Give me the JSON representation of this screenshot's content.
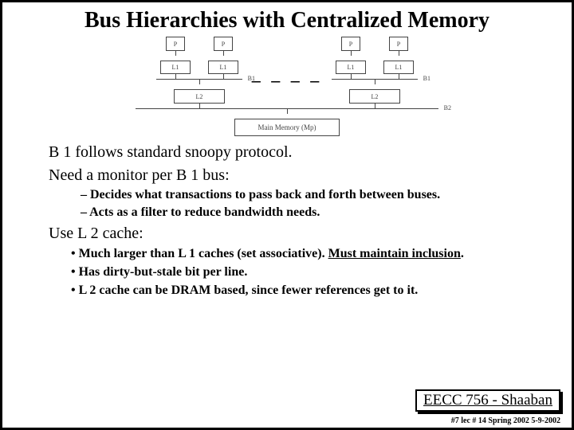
{
  "title": "Bus Hierarchies with Centralized Memory",
  "diagram": {
    "p": "P",
    "l1": "L1",
    "l2": "L2",
    "b1": "B1",
    "b2": "B2",
    "mem": "Main Memory (Mp)"
  },
  "bullets": {
    "a": "B 1 follows standard snoopy protocol.",
    "b": "Need a monitor per B 1 bus:",
    "b1": "Decides what transactions to pass back and forth between buses.",
    "b2": "Acts as a filter to reduce bandwidth needs.",
    "c": "Use L 2 cache:",
    "c1a": "Much larger than L 1 caches (set associative).   ",
    "c1b": "Must maintain inclusion",
    "c2": "Has dirty-but-stale bit per line.",
    "c3": "L 2 cache can be DRAM based, since fewer references get to it."
  },
  "footer": {
    "course": "EECC 756 - Shaaban",
    "meta": "#7  lec # 14    Spring 2002   5-9-2002"
  }
}
